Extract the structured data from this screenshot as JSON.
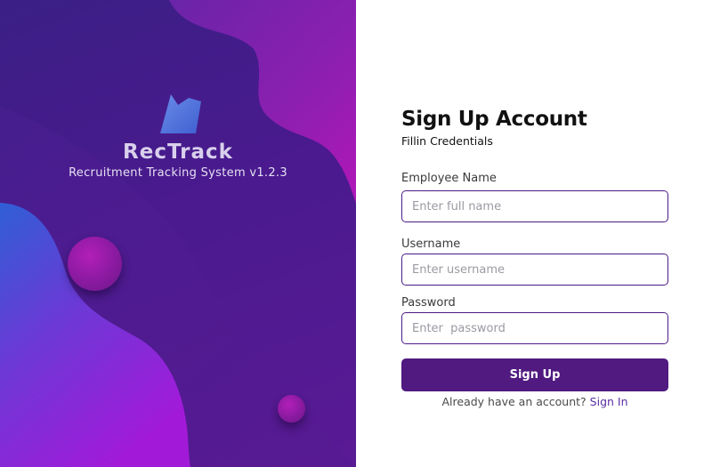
{
  "brand": {
    "title": "RecTrack",
    "subtitle": "Recruitment Tracking System v1.2.3",
    "logo_icon": "bookmark-flag-icon",
    "colors": {
      "panel_base": "#3b1f86",
      "accent_magenta": "#a81cb3",
      "accent_blue": "#2f5fd6"
    }
  },
  "form": {
    "title": "Sign Up Account",
    "subtitle": "Fillin Credentials",
    "fields": [
      {
        "label": "Employee Name",
        "placeholder": "Enter full name",
        "value": ""
      },
      {
        "label": "Username",
        "placeholder": "Enter username",
        "value": ""
      },
      {
        "label": "Password",
        "placeholder": "Enter  password",
        "value": ""
      }
    ],
    "submit_label": "Sign Up",
    "signin_prompt": "Already have an account?",
    "signin_link": "Sign In",
    "colors": {
      "primary": "#501a80",
      "input_border": "#4b1a86"
    }
  }
}
